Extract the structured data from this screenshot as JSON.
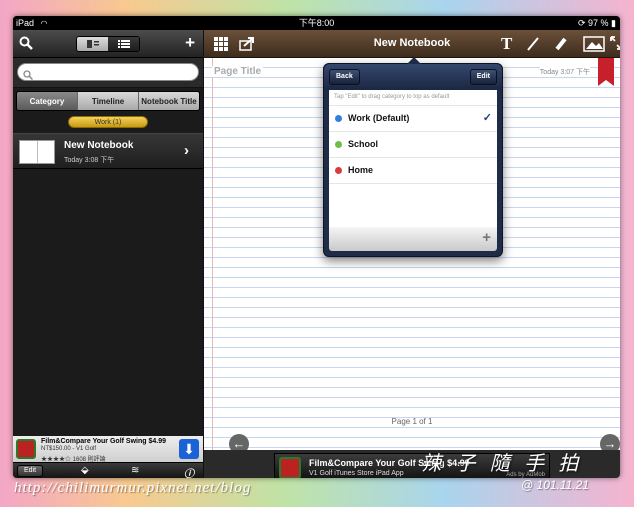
{
  "status": {
    "device": "iPad",
    "time": "下午8:00",
    "battery": "97 %"
  },
  "left": {
    "tabs": [
      {
        "label": "Category",
        "active": true
      },
      {
        "label": "Timeline",
        "active": false
      },
      {
        "label": "Notebook Title",
        "active": false
      }
    ],
    "category_pill": "Work (1)",
    "notebook": {
      "title": "New Notebook",
      "time": "Today 3:08 下午"
    },
    "ad": {
      "title": "Film&Compare Your Golf Swing $4.99",
      "price_line": "NT$150.00 - V1 Golf",
      "rating_line": "★★★★☆ 1608 則評論"
    },
    "bottom": {
      "edit_label": "Edit"
    }
  },
  "editor": {
    "title": "New Notebook",
    "page_title": "Page Title",
    "page_date": "Today 3:07 下午",
    "page_indicator": "Page 1 of 1"
  },
  "popover": {
    "back_label": "Back",
    "edit_label": "Edit",
    "hint": "Tap \"Edit\" to drag category to top as default",
    "categories": [
      {
        "label": "Work (Default)",
        "color": "#2f7fe0",
        "checked": true
      },
      {
        "label": "School",
        "color": "#6cc04a",
        "checked": false
      },
      {
        "label": "Home",
        "color": "#d93a3a",
        "checked": false
      }
    ],
    "check_mark": "✓"
  },
  "ad_bottom": {
    "title": "Film&Compare Your Golf Swing $4.99",
    "subtitle": "V1 Golf iTunes Store iPad App",
    "badge": "Ads by AdMob"
  },
  "watermark": {
    "url": "http://chilimurmur.pixnet.net/blog",
    "date": "@ 101.11.21",
    "signature": "辣 子 隨 手 拍"
  }
}
